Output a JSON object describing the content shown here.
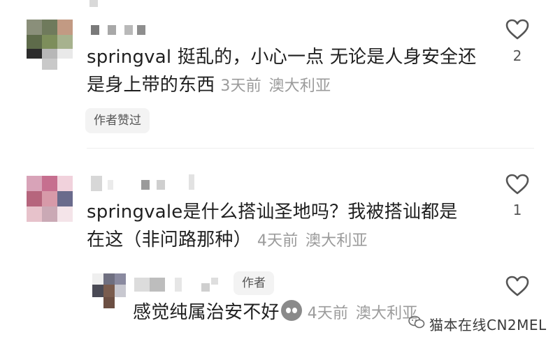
{
  "comments": [
    {
      "username_display": "",
      "text": "springval 挺乱的，小心一点 无论是人身安全还",
      "text2": "是身上带的东西",
      "time": "3天前",
      "location": "澳大利亚",
      "chip": "作者赞过",
      "like_count": "2"
    },
    {
      "text": "springvale是什么搭讪圣地吗？我被搭讪都是",
      "text2": "在这（非问路那种）",
      "time": "4天前",
      "location": "澳大利亚",
      "like_count": "1"
    }
  ],
  "reply": {
    "author_tag": "作者",
    "text": "感觉纯属治安不好",
    "time": "4天前",
    "location": "澳大利亚",
    "emoji": "neutral-face-icon"
  },
  "watermark": {
    "text": "猫本在线CN2MEL"
  },
  "colors": {
    "text": "#1f1f1f",
    "meta": "#9b9b9b",
    "chip_bg": "#f3f3f3",
    "icon": "#555555"
  }
}
